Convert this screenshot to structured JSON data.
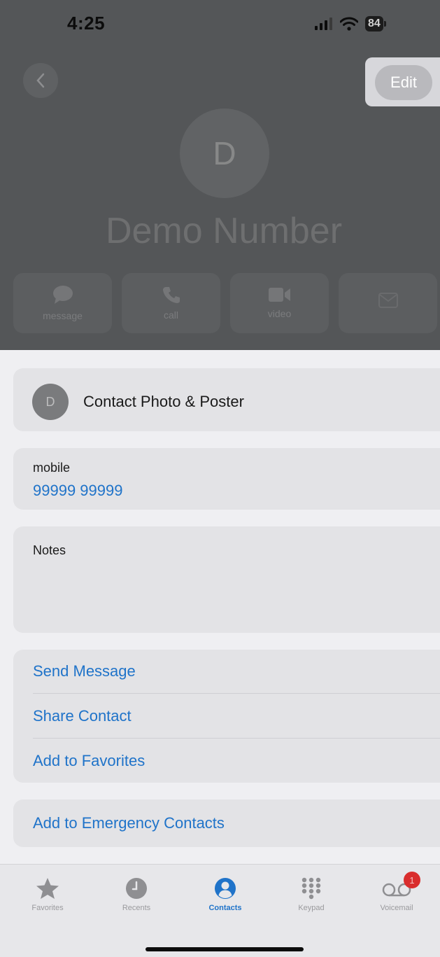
{
  "status_bar": {
    "time": "4:25",
    "battery": "84"
  },
  "nav": {
    "edit_label": "Edit"
  },
  "contact": {
    "initial": "D",
    "name": "Demo Number"
  },
  "actions": [
    {
      "label": "message",
      "icon": "message-bubble-icon"
    },
    {
      "label": "call",
      "icon": "phone-icon"
    },
    {
      "label": "video",
      "icon": "video-camera-icon"
    },
    {
      "label": "",
      "icon": "mail-icon"
    }
  ],
  "photo_card": {
    "initial": "D",
    "label": "Contact Photo & Poster"
  },
  "phone": {
    "label": "mobile",
    "number": "99999 99999"
  },
  "notes": {
    "label": "Notes"
  },
  "links": {
    "send_message": "Send Message",
    "share_contact": "Share Contact",
    "add_favorites": "Add to Favorites",
    "emergency": "Add to Emergency Contacts"
  },
  "tabs": [
    {
      "label": "Favorites",
      "icon": "star-icon"
    },
    {
      "label": "Recents",
      "icon": "clock-icon"
    },
    {
      "label": "Contacts",
      "icon": "person-circle-icon",
      "active": true
    },
    {
      "label": "Keypad",
      "icon": "keypad-icon"
    },
    {
      "label": "Voicemail",
      "icon": "voicemail-icon",
      "badge": "1"
    }
  ],
  "colors": {
    "accent": "#1f73c9",
    "badge": "#d92d2d"
  }
}
